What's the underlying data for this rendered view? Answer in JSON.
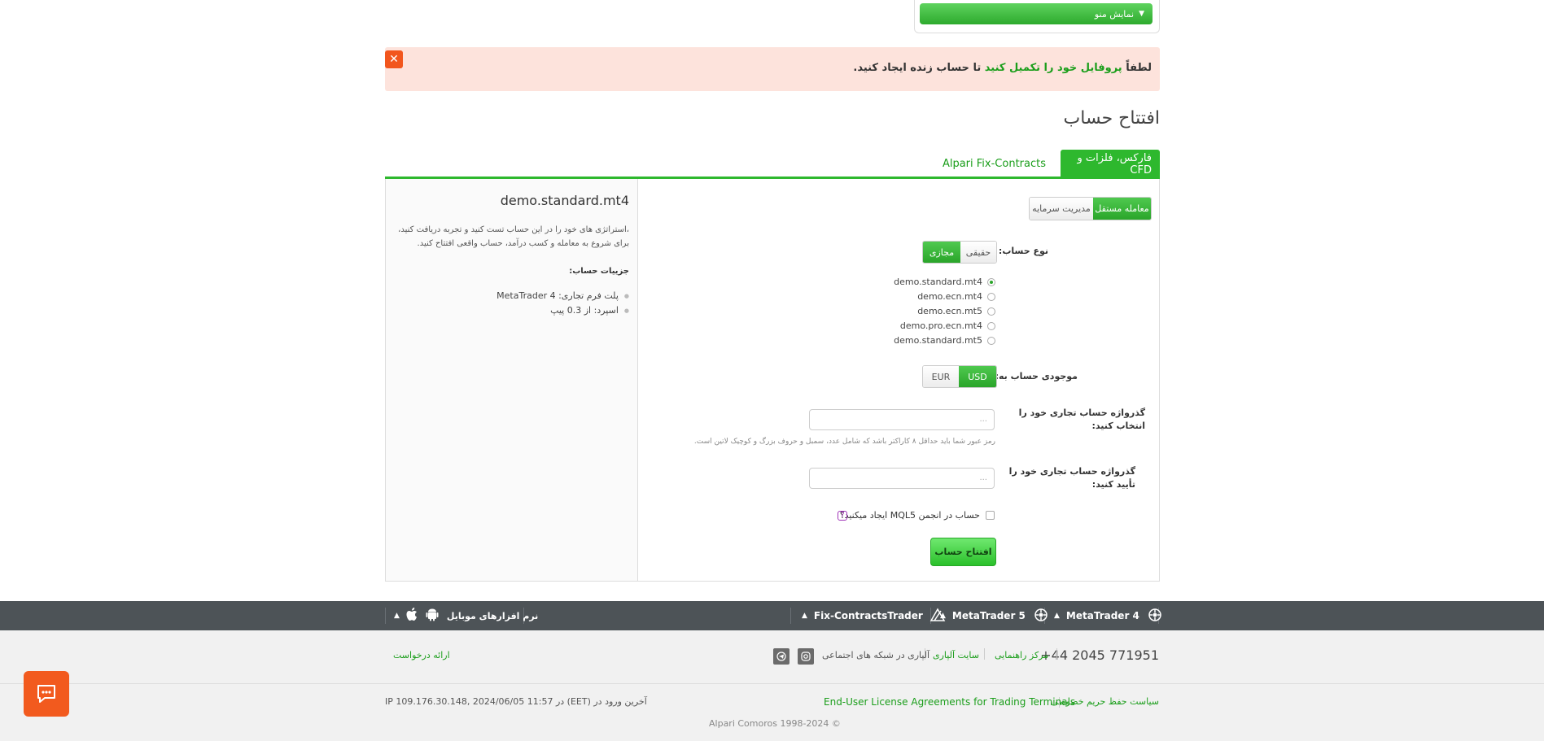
{
  "menu": {
    "label": "نمایش منو",
    "arrow": "▼"
  },
  "alert": {
    "close": "✕",
    "prefix": "لطفاً",
    "link": "پروفایل خود را تکمیل کنید",
    "suffix": "تا حساب زنده ایجاد کنید."
  },
  "page_title": "افتتاح حساب",
  "tabs": [
    {
      "label": "فارکس، فلزات و CFD",
      "active": true
    },
    {
      "label": "Alpari Fix-Contracts",
      "active": false
    }
  ],
  "trade_mode": {
    "options": [
      "معامله مستقل",
      "مدیریت سرمایه"
    ],
    "selected": "معامله مستقل"
  },
  "account_type": {
    "label": "نوع حساب:",
    "options": [
      "مجازی",
      "حقیقی"
    ],
    "selected": "مجازی",
    "accounts": [
      "demo.standard.mt4",
      "demo.ecn.mt4",
      "demo.ecn.mt5",
      "demo.pro.ecn.mt4",
      "demo.standard.mt5"
    ],
    "selected_account": "demo.standard.mt4"
  },
  "currency": {
    "label": "موجودی حساب به:",
    "options": [
      "USD",
      "EUR"
    ],
    "selected": "USD"
  },
  "password": {
    "label": "گذرواژه حساب تجاری خود را انتخاب کنید:",
    "placeholder": "...",
    "hint": "رمز عبور شما باید حداقل ۸ کاراکتر باشد که شامل عدد، سمبل و حروف بزرگ و کوچیک لاتین است."
  },
  "confirm_password": {
    "label": "گذرواژه حساب تجاری خود را تأیید کنید:",
    "placeholder": "..."
  },
  "mql5": {
    "label": "حساب در انجمن MQL5 ایجاد میکنید؟",
    "help": "?"
  },
  "submit_label": "افتتاح حساب",
  "details": {
    "title": "demo.standard.mt4",
    "description": "،استراتژی های خود را در این حساب تست کنید و تجربه دریافت کنید، برای شروع به معامله و کسب درآمد، حساب واقعی افتتاح کنید.",
    "subtitle": "جزییات حساب:",
    "items": [
      "پلت فرم تجاری: MetaTrader 4",
      "اسپرد: از 0.3 پیپ"
    ]
  },
  "platform_bar": {
    "items": [
      "MetaTrader 4",
      "MetaTrader 5",
      "Fix-ContractsTrader"
    ],
    "mobile": "نرم افزارهای موبایل",
    "arrow": "▲"
  },
  "footer": {
    "phone": "+44 2045 771951",
    "help_center": "مرکز راهنمایی",
    "site": "سایت آلپاری",
    "social": "آلپاری در شبکه های اجتماعی",
    "request": "ارائه درخواست",
    "privacy": "سیاست حفظ حریم خصوصی",
    "eula": "End-User License Agreements for Trading Terminals",
    "last_login": "IP 109.176.30.148, 2024/06/05 11:57 در (EET) آخرین ورود در",
    "copyright": "Alpari Comoros 1998-2024 ©"
  },
  "colors": {
    "accent": "#2eb82e",
    "alert_bg": "#fde3dc",
    "alert_close": "#f2561d",
    "dark_bar": "#4d5357",
    "chat": "#f25a1e"
  }
}
